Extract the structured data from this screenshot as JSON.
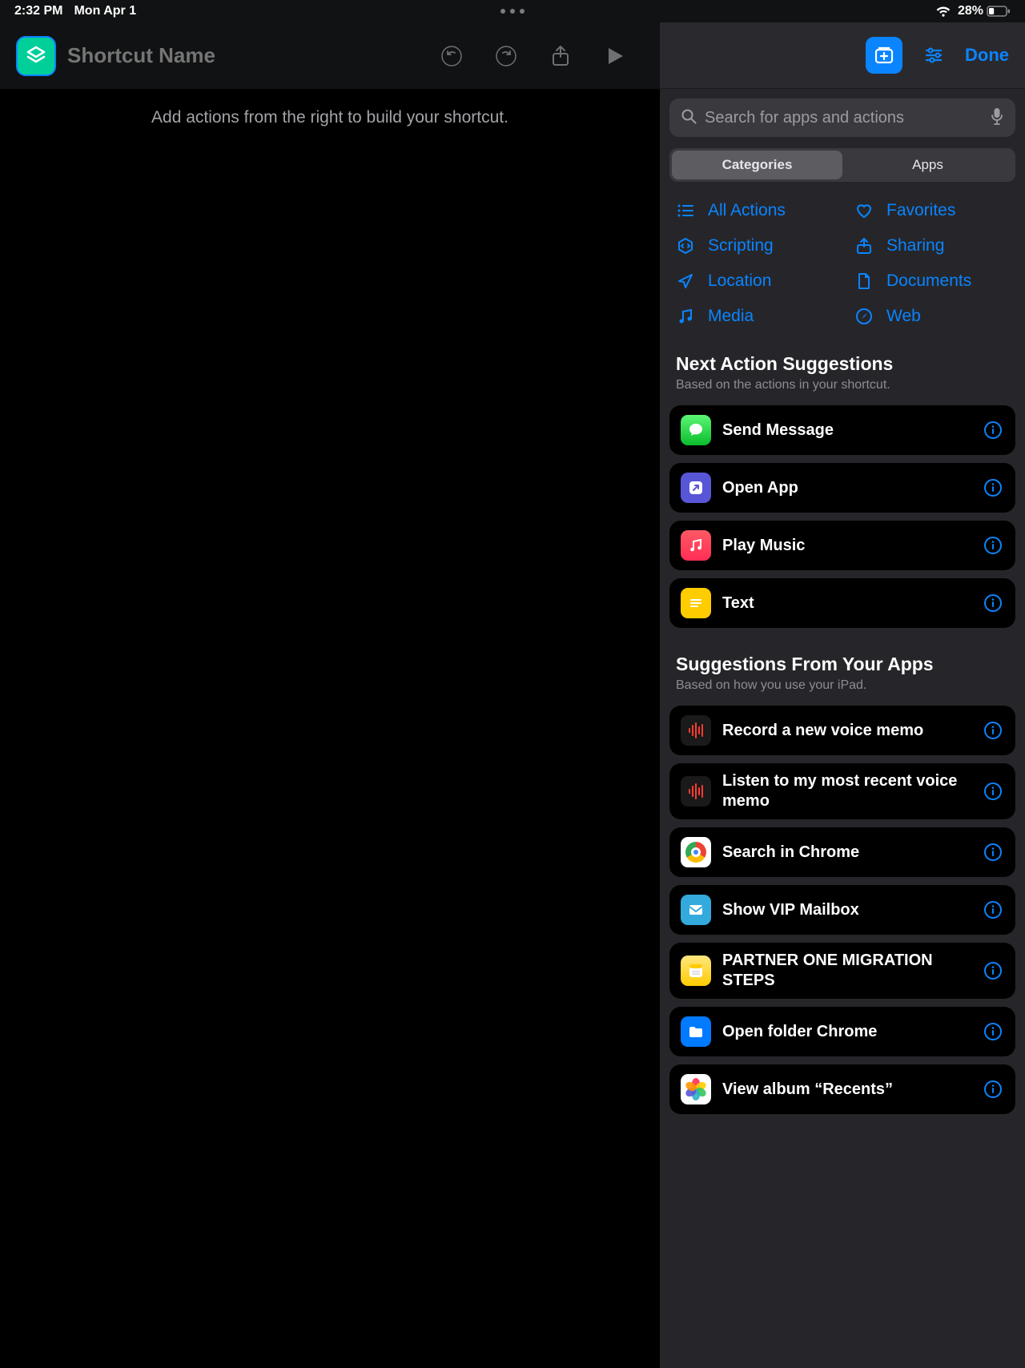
{
  "status": {
    "time": "2:32 PM",
    "date": "Mon Apr 1",
    "battery": "28%"
  },
  "editor": {
    "title_placeholder": "Shortcut Name",
    "canvas_hint": "Add actions from the right to build your shortcut."
  },
  "library": {
    "done": "Done",
    "search_placeholder": "Search for apps and actions",
    "segments": {
      "categories": "Categories",
      "apps": "Apps",
      "active": "categories"
    },
    "categories": [
      {
        "label": "All Actions",
        "icon": "list"
      },
      {
        "label": "Favorites",
        "icon": "heart"
      },
      {
        "label": "Scripting",
        "icon": "brace"
      },
      {
        "label": "Sharing",
        "icon": "share"
      },
      {
        "label": "Location",
        "icon": "location"
      },
      {
        "label": "Documents",
        "icon": "doc"
      },
      {
        "label": "Media",
        "icon": "music"
      },
      {
        "label": "Web",
        "icon": "safari"
      }
    ],
    "next_section": {
      "title": "Next Action Suggestions",
      "subtitle": "Based on the actions in your shortcut.",
      "items": [
        {
          "label": "Send Message",
          "icon": "messages"
        },
        {
          "label": "Open App",
          "icon": "openapp"
        },
        {
          "label": "Play Music",
          "icon": "music-app"
        },
        {
          "label": "Text",
          "icon": "text"
        }
      ]
    },
    "apps_section": {
      "title": "Suggestions From Your Apps",
      "subtitle": "Based on how you use your iPad.",
      "items": [
        {
          "label": "Record a new voice memo",
          "icon": "voicememo"
        },
        {
          "label": "Listen to my most recent voice memo",
          "icon": "voicememo"
        },
        {
          "label": "Search in Chrome",
          "icon": "chrome"
        },
        {
          "label": "Show VIP Mailbox",
          "icon": "mail"
        },
        {
          "label": "PARTNER ONE MIGRATION STEPS",
          "icon": "notes"
        },
        {
          "label": "Open folder Chrome",
          "icon": "files"
        },
        {
          "label": "View album “Recents”",
          "icon": "photos"
        }
      ]
    }
  }
}
